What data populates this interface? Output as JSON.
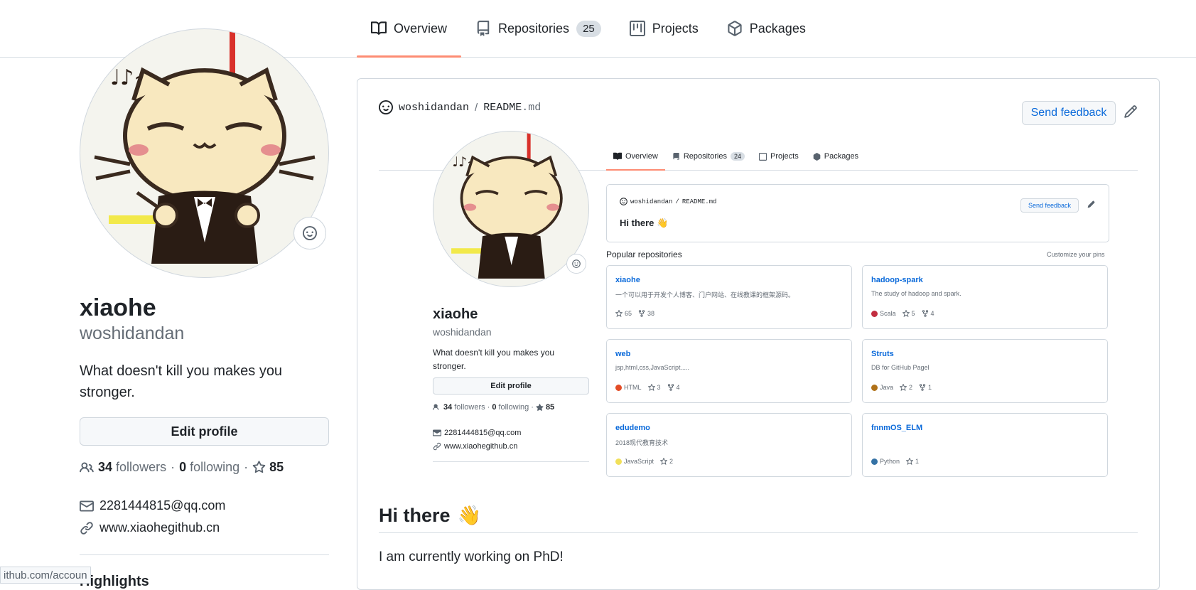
{
  "nav": {
    "tabs": [
      {
        "label": "Overview",
        "icon": "book-icon",
        "selected": true
      },
      {
        "label": "Repositories",
        "icon": "repo-icon",
        "count": "25"
      },
      {
        "label": "Projects",
        "icon": "project-icon"
      },
      {
        "label": "Packages",
        "icon": "package-icon"
      }
    ]
  },
  "profile": {
    "name": "xiaohe",
    "username": "woshidandan",
    "bio": "What doesn't kill you makes you stronger.",
    "edit_label": "Edit profile",
    "followers_count": "34",
    "followers_label": "followers",
    "separator": "·",
    "following_count": "0",
    "following_label": "following",
    "stars_count": "85",
    "email": "2281444815@qq.com",
    "website": "www.xiaohegithub.cn",
    "highlights_label": "Highlights"
  },
  "status_bar_url": "ithub.com/accoun",
  "readme": {
    "owner": "woshidandan",
    "slash": "/",
    "file_base": "README",
    "file_ext": ".md",
    "feedback_label": "Send feedback",
    "heading": "Hi there",
    "heading_emoji": "👋",
    "text": "I am currently working on PhD!"
  },
  "embedded": {
    "tabs": [
      {
        "label": "Overview",
        "selected": true
      },
      {
        "label": "Repositories",
        "count": "24"
      },
      {
        "label": "Projects"
      },
      {
        "label": "Packages"
      }
    ],
    "name": "xiaohe",
    "username": "woshidandan",
    "bio": "What doesn't kill you makes you stronger.",
    "edit_label": "Edit profile",
    "followers_count": "34",
    "followers_label": "followers",
    "following_count": "0",
    "following_label": "following",
    "stars_count": "85",
    "email": "2281444815@qq.com",
    "website": "www.xiaohegithub.cn",
    "readme_owner": "woshidandan",
    "readme_file": "README.md",
    "feedback_label": "Send feedback",
    "hi": "Hi there 👋",
    "popular_label": "Popular repositories",
    "customize_label": "Customize your pins",
    "repos": [
      {
        "name": "xiaohe",
        "desc": "一个可以用于开发个人博客、门户网站、在线教课的框架源码。",
        "lang": "",
        "color": "",
        "stars": "65",
        "forks": "38"
      },
      {
        "name": "hadoop-spark",
        "desc": "The study of hadoop and spark.",
        "lang": "Scala",
        "color": "#c22d40",
        "stars": "5",
        "forks": "4"
      },
      {
        "name": "web",
        "desc": "jsp,html,css,JavaScript.....",
        "lang": "HTML",
        "color": "#e34c26",
        "stars": "3",
        "forks": "4"
      },
      {
        "name": "Struts",
        "desc": "DB for GitHub Pagel",
        "lang": "Java",
        "color": "#b07219",
        "stars": "2",
        "forks": "1"
      },
      {
        "name": "edudemo",
        "desc": "2018现代教育技术",
        "lang": "JavaScript",
        "color": "#f1e05a",
        "stars": "2",
        "forks": ""
      },
      {
        "name": "fnnmOS_ELM",
        "desc": "",
        "lang": "Python",
        "color": "#3572A5",
        "stars": "1",
        "forks": ""
      }
    ]
  },
  "colors": {
    "accent": "#fd8c73",
    "link": "#0969da",
    "border": "#d0d7de"
  }
}
